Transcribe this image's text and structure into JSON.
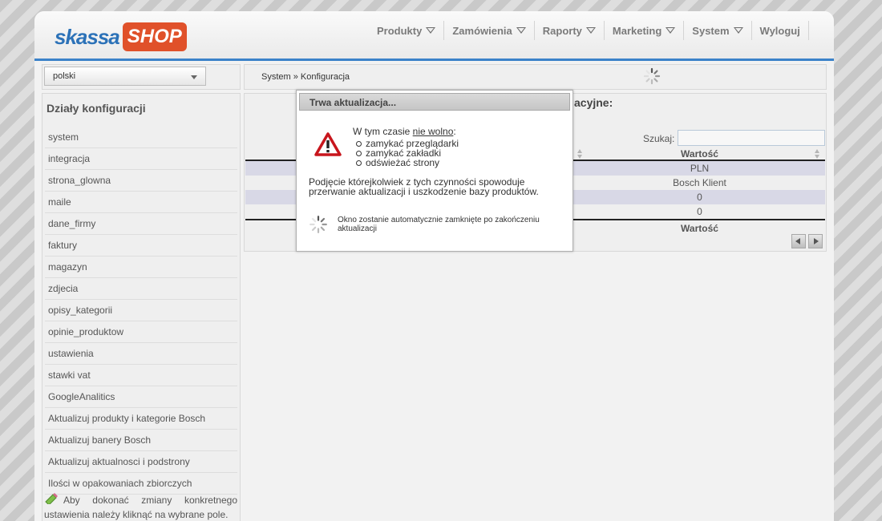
{
  "colors": {
    "accent": "#3b82c9",
    "logo_blue": "#2c72b8",
    "logo_orange": "#e0512a",
    "row_alt": "#d8d8e6"
  },
  "logo": {
    "part1": "skassa",
    "part2": "SHOP"
  },
  "nav": [
    {
      "label": "Produkty",
      "has_dropdown": true
    },
    {
      "label": "Zamówienia",
      "has_dropdown": true
    },
    {
      "label": "Raporty",
      "has_dropdown": true
    },
    {
      "label": "Marketing",
      "has_dropdown": true
    },
    {
      "label": "System",
      "has_dropdown": true
    },
    {
      "label": "Wyloguj",
      "has_dropdown": false
    }
  ],
  "language": {
    "selected": "polski"
  },
  "breadcrumb": "System » Konfiguracja",
  "sidebar": {
    "title": "Działy konfiguracji",
    "items": [
      "system",
      "integracja",
      "strona_glowna",
      "maile",
      "dane_firmy",
      "faktury",
      "magazyn",
      "zdjecia",
      "opisy_kategorii",
      "opinie_produktow",
      "ustawienia",
      "stawki vat",
      "GoogleAnalitics",
      "Aktualizuj produkty i kategorie Bosch",
      "Aktualizuj banery Bosch",
      "Aktualizuj aktualnosci i podstrony",
      "Ilości w opakowaniach zbiorczych"
    ],
    "note": "Aby dokonać zmiany konkretnego ustawienia należy kliknąć na wybrane pole."
  },
  "content": {
    "title_fragment": "acyjne:",
    "search_label": "Szukaj:",
    "search_value": "",
    "column_header": "Wartość",
    "rows": [
      "PLN",
      "Bosch Klient",
      "0",
      "0"
    ],
    "column_footer": "Wartość"
  },
  "modal": {
    "title": "Trwa aktualizacja...",
    "lead_prefix": "W tym czasie ",
    "lead_emph": "nie wolno",
    "lead_suffix": ":",
    "list": [
      "zamykać przeglądarki",
      "zamykać zakładki",
      "odświeżać strony"
    ],
    "warning": "Podjęcie którejkolwiek z tych czynności spowoduje przerwanie aktualizacji i uszkodzenie bazy produktów.",
    "close_note": "Okno zostanie automatycznie zamknięte po zakończeniu aktualizacji"
  }
}
